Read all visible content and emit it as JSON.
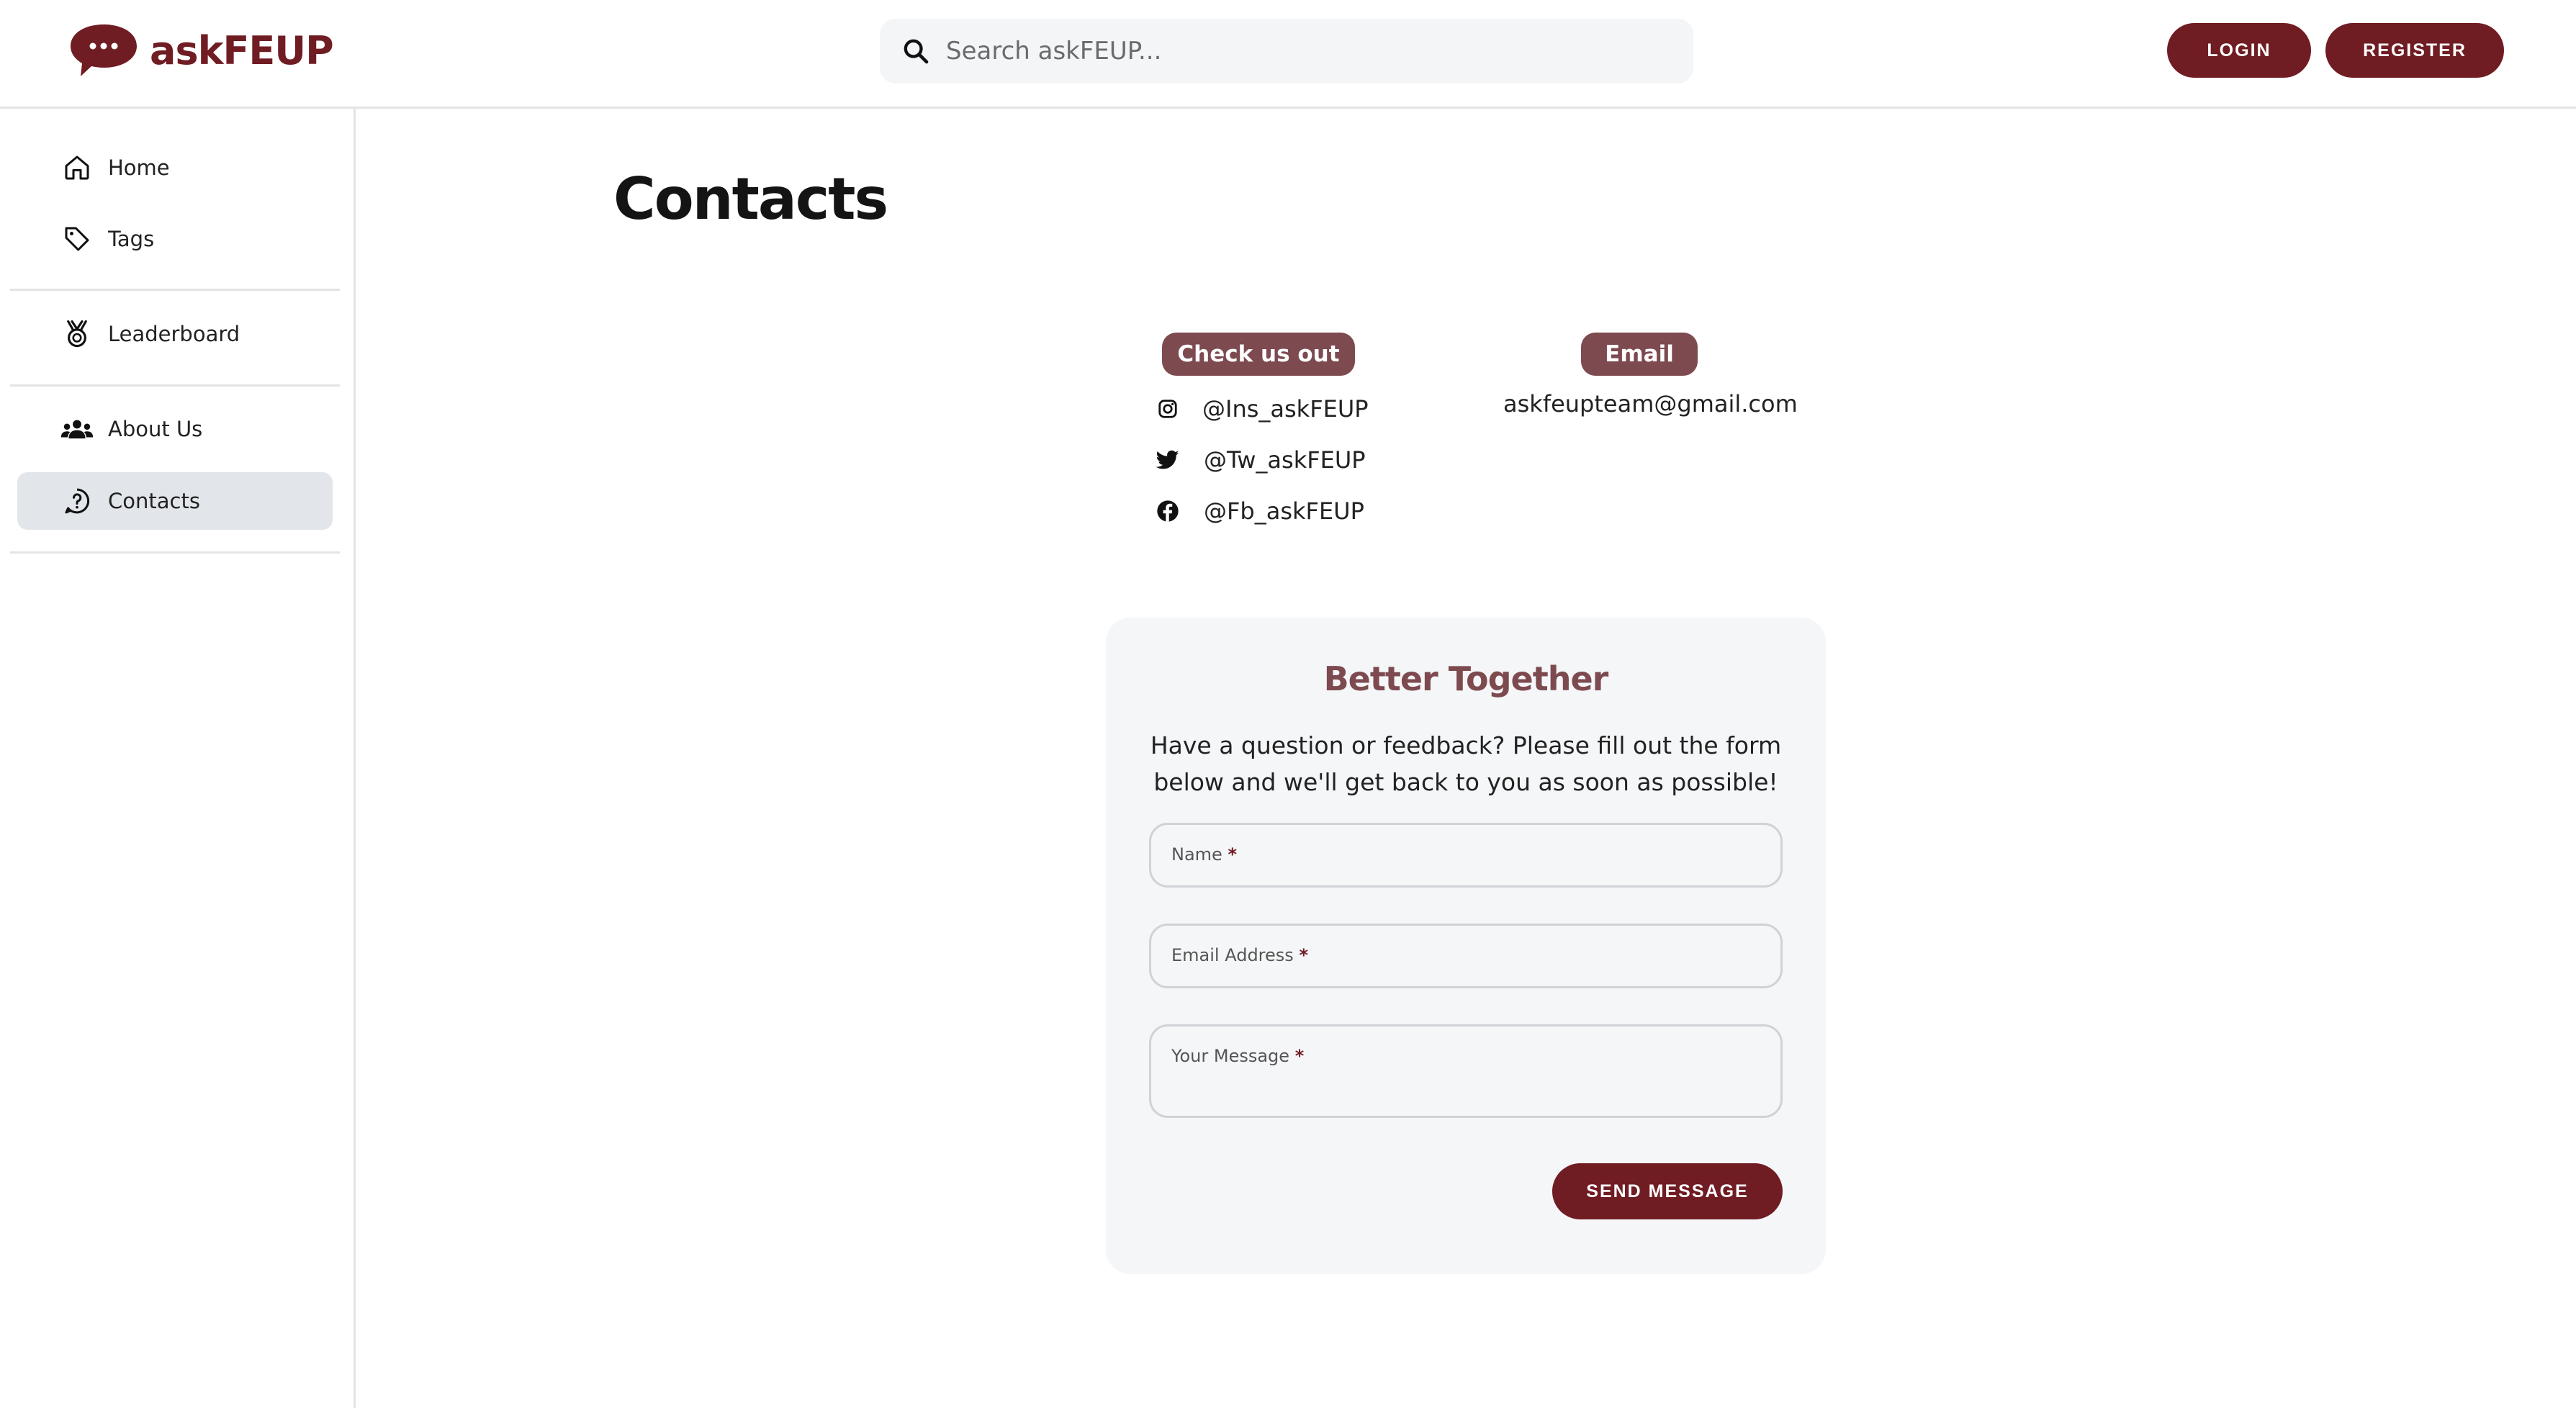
{
  "brand": {
    "name": "askFEUP",
    "color": "#701c23"
  },
  "header": {
    "search_placeholder": "Search askFEUP...",
    "login_label": "LOGIN",
    "register_label": "REGISTER"
  },
  "sidebar": {
    "items": [
      {
        "label": "Home",
        "icon": "home-icon"
      },
      {
        "label": "Tags",
        "icon": "tag-icon"
      },
      {
        "label": "Leaderboard",
        "icon": "medal-icon"
      },
      {
        "label": "About Us",
        "icon": "users-icon"
      },
      {
        "label": "Contacts",
        "icon": "help-circle-icon",
        "active": true
      }
    ]
  },
  "main": {
    "title": "Contacts",
    "social": {
      "heading": "Check us out",
      "links": [
        {
          "icon": "instagram-icon",
          "handle": "@Ins_askFEUP"
        },
        {
          "icon": "twitter-icon",
          "handle": "@Tw_askFEUP"
        },
        {
          "icon": "facebook-icon",
          "handle": "@Fb_askFEUP"
        }
      ]
    },
    "email": {
      "heading": "Email",
      "address": "askfeupteam@gmail.com"
    },
    "form": {
      "title": "Better Together",
      "description": "Have a question or feedback? Please fill out the form below and we'll get back to you as soon as possible!",
      "name_label": "Name",
      "email_label": "Email Address",
      "message_label": "Your Message",
      "required_mark": "*",
      "submit_label": "SEND MESSAGE"
    }
  },
  "colors": {
    "accent": "#701c23",
    "chip": "#7d4a50",
    "active_item_bg": "#e2e6ea",
    "card_bg": "#f5f6f8"
  }
}
